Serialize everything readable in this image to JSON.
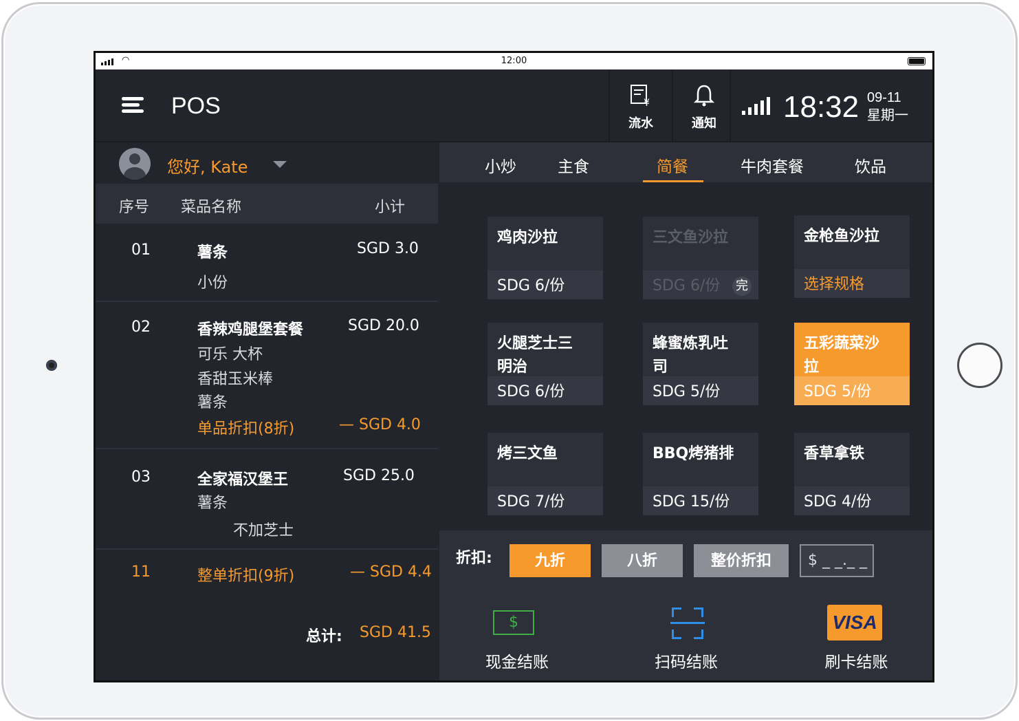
{
  "status_bar": {
    "time": "12:00"
  },
  "header": {
    "title": "POS",
    "flow_label": "流水",
    "notify_label": "通知",
    "clock": "18:32",
    "date": "09-11",
    "weekday": "星期一"
  },
  "user": {
    "greeting": "您好, Kate"
  },
  "order_table": {
    "headers": {
      "no": "序号",
      "name": "菜品名称",
      "subtotal": "小计"
    },
    "rows": [
      {
        "no": "01",
        "name": "薯条",
        "price": "SGD 3.0",
        "options": [
          "小份"
        ]
      },
      {
        "no": "02",
        "name": "香辣鸡腿堡套餐",
        "price": "SGD 20.0",
        "options": [
          "可乐  大杯",
          "香甜玉米棒",
          "薯条"
        ],
        "discount_label": "单品折扣(8折)",
        "discount_value": "— SGD 4.0"
      },
      {
        "no": "03",
        "name": "全家福汉堡王",
        "price": "SGD 25.0",
        "options": [
          "薯条",
          "不加芝士"
        ]
      }
    ],
    "order_discount": {
      "no": "11",
      "label": "整单折扣(9折)",
      "value": "— SGD 4.4"
    },
    "total_label": "总计:",
    "total_value": "SGD 41.5"
  },
  "tabs": [
    "小炒",
    "主食",
    "简餐",
    "牛肉套餐",
    "饮品"
  ],
  "active_tab": "简餐",
  "menu": [
    {
      "name": "鸡肉沙拉",
      "price": "SDG 6/份"
    },
    {
      "name": "三文鱼沙拉",
      "price": "SDG 6/份",
      "badge": "完"
    },
    {
      "name": "金枪鱼沙拉",
      "price": "选择规格"
    },
    {
      "name": "火腿芝士三明治",
      "price": "SDG 6/份"
    },
    {
      "name": "蜂蜜炼乳吐司",
      "price": "SDG 5/份"
    },
    {
      "name": "五彩蔬菜沙拉",
      "price": "SDG 5/份"
    },
    {
      "name": "烤三文鱼",
      "price": "SDG 7/份"
    },
    {
      "name": "BBQ烤猪排",
      "price": "SDG 15/份"
    },
    {
      "name": "香草拿铁",
      "price": "SDG 4/份"
    }
  ],
  "discount": {
    "label": "折扣:",
    "options": [
      "九折",
      "八折",
      "整价折扣"
    ],
    "custom_placeholder": "$ _ _._ _"
  },
  "payment": {
    "cash_symbol": "$",
    "cash_label": "现金结账",
    "scan_label": "扫码结账",
    "card_logo": "VISA",
    "card_label": "刷卡结账"
  },
  "colors": {
    "accent": "#f79a2e",
    "background": "#22252b",
    "panel": "#2d3038",
    "cash": "#3fae49",
    "scan": "#2f8fe6"
  },
  "icons": [
    "menu-icon",
    "receipt-icon",
    "bell-icon",
    "signal-icon",
    "avatar-icon",
    "chevron-down-icon",
    "cash-icon",
    "qr-scan-icon",
    "visa-card-icon"
  ]
}
